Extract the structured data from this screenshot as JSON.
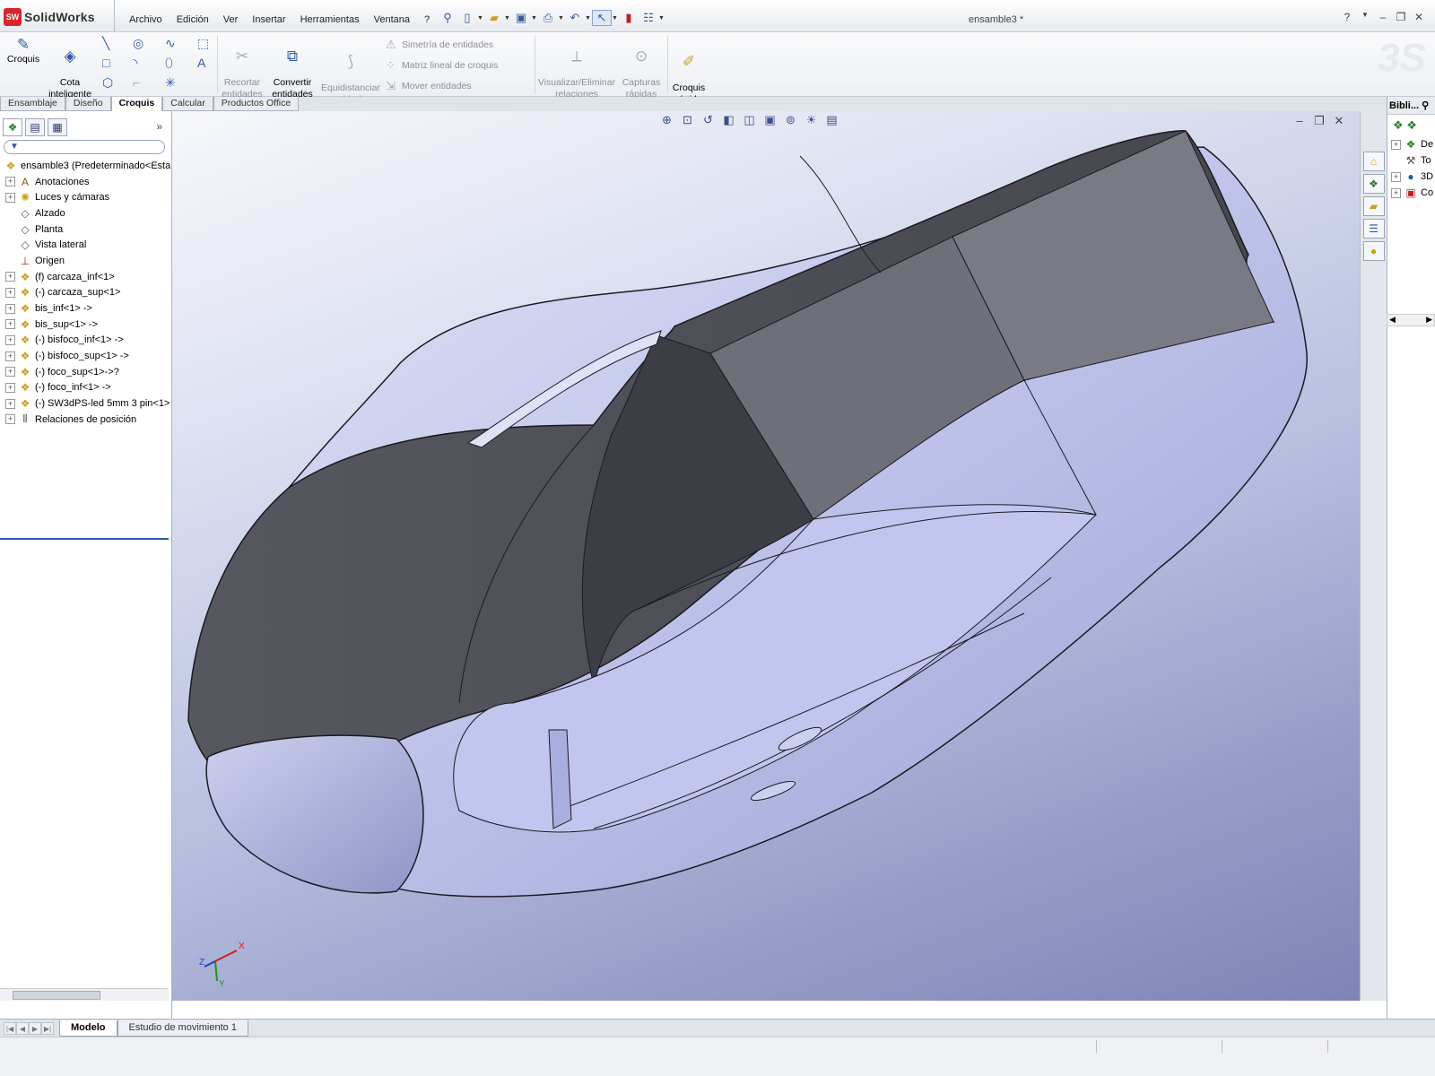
{
  "app": {
    "name": "SolidWorks",
    "badge": "SW",
    "document_title": "ensamble3 *"
  },
  "menu": [
    "Archivo",
    "Edición",
    "Ver",
    "Insertar",
    "Herramientas",
    "Ventana",
    "?"
  ],
  "ribbon": {
    "croquis": "Croquis",
    "cota": "Cota\ninteligente",
    "recortar": "Recortar\nentidades",
    "convertir": "Convertir\nentidades",
    "equidistanciar": "Equidistanciar\nentidades",
    "simetria": "Simetría de entidades",
    "matriz": "Matriz lineal de croquis",
    "mover": "Mover entidades",
    "visualizar": "Visualizar/Eliminar\nrelaciones",
    "capturas": "Capturas\nrápidas",
    "croquis_rapido": "Croquis\nrápido"
  },
  "command_tabs": [
    {
      "label": "Ensamblaje",
      "active": false
    },
    {
      "label": "Diseño",
      "active": false
    },
    {
      "label": "Croquis",
      "active": true
    },
    {
      "label": "Calcular",
      "active": false
    },
    {
      "label": "Productos Office",
      "active": false
    }
  ],
  "feature_tree": [
    {
      "label": "ensamble3  (Predeterminado<Esta",
      "type": "root",
      "icon": "assembly-icon"
    },
    {
      "label": "Anotaciones",
      "exp": "+",
      "icon": "annotation-icon"
    },
    {
      "label": "Luces y cámaras",
      "exp": "+",
      "icon": "lights-icon"
    },
    {
      "label": "Alzado",
      "exp": "",
      "icon": "plane-icon"
    },
    {
      "label": "Planta",
      "exp": "",
      "icon": "plane-icon"
    },
    {
      "label": "Vista lateral",
      "exp": "",
      "icon": "plane-icon"
    },
    {
      "label": "Origen",
      "exp": "",
      "icon": "origin-icon"
    },
    {
      "label": "(f) carcaza_inf<1>",
      "exp": "+",
      "icon": "part-icon"
    },
    {
      "label": "(-) carcaza_sup<1>",
      "exp": "+",
      "icon": "part-icon"
    },
    {
      "label": "bis_inf<1> ->",
      "exp": "+",
      "icon": "part-icon"
    },
    {
      "label": "bis_sup<1> ->",
      "exp": "+",
      "icon": "part-icon"
    },
    {
      "label": "(-) bisfoco_inf<1> ->",
      "exp": "+",
      "icon": "part-icon"
    },
    {
      "label": "(-) bisfoco_sup<1> ->",
      "exp": "+",
      "icon": "part-icon"
    },
    {
      "label": "(-) foco_sup<1>->?",
      "exp": "+",
      "icon": "part-icon"
    },
    {
      "label": "(-) foco_inf<1> ->",
      "exp": "+",
      "icon": "part-icon"
    },
    {
      "label": "(-) SW3dPS-led 5mm 3 pin<1>",
      "exp": "+",
      "icon": "part-icon"
    },
    {
      "label": "Relaciones de posición",
      "exp": "+",
      "icon": "mates-icon"
    }
  ],
  "task_pane": {
    "title": "Bibli...",
    "items": [
      {
        "label": "De",
        "exp": "+"
      },
      {
        "label": "To",
        "exp": ""
      },
      {
        "label": "3D",
        "exp": "+"
      },
      {
        "label": "Co",
        "exp": "+"
      }
    ]
  },
  "bottom_tabs": [
    {
      "label": "Modelo",
      "active": true
    },
    {
      "label": "Estudio de movimiento 1",
      "active": false
    }
  ],
  "triad": {
    "x": "X",
    "y": "Y",
    "z": "Z"
  },
  "colors": {
    "accent": "#2f5aa8",
    "model_dark": "#4a4b55",
    "model_light": "#b8bce6",
    "brand": "#d8262f"
  }
}
